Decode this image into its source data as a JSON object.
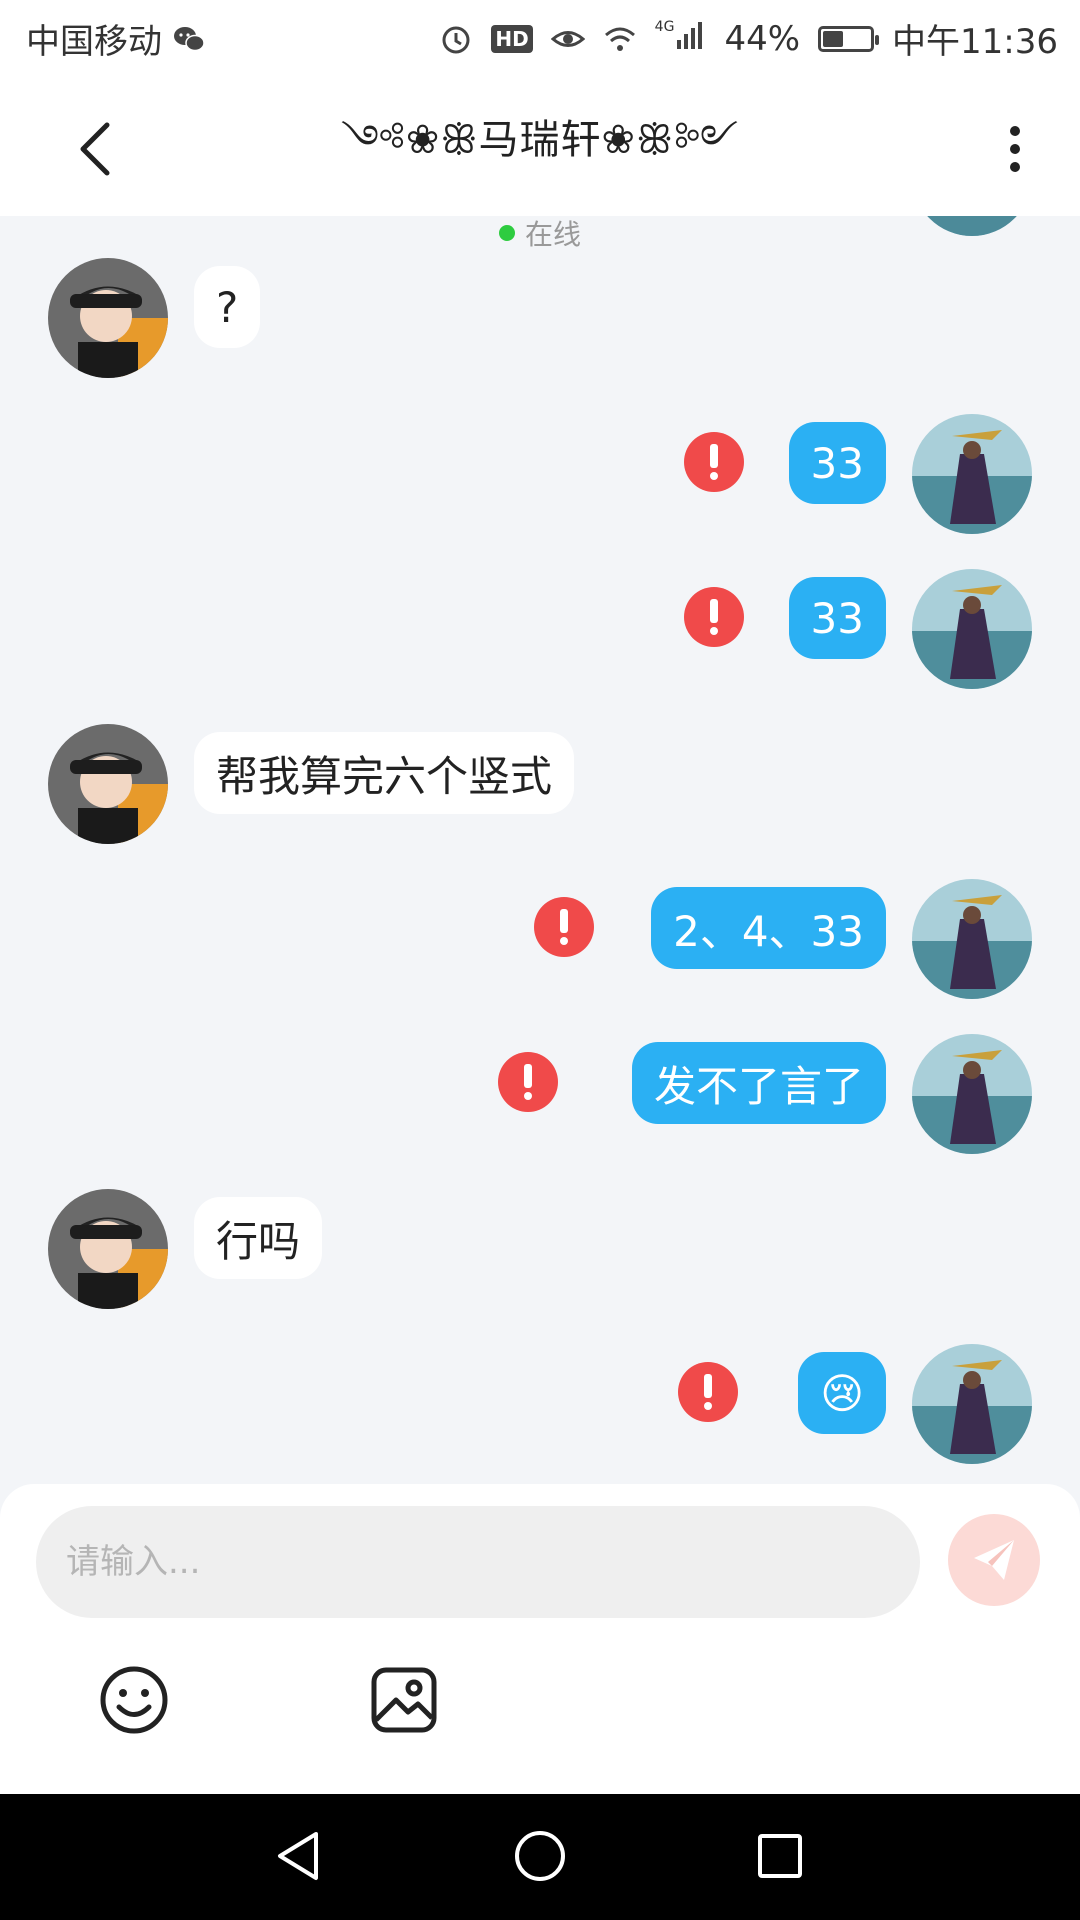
{
  "status_bar": {
    "carrier": "中国移动",
    "hd": "HD",
    "network": "4G",
    "battery": "44%",
    "battery_level": 0.44,
    "time": "中午11:36"
  },
  "header": {
    "title": "༺❀ꕥ马瑞轩❀ꕥ༻",
    "status": "在线",
    "status_color": "#2ecc40"
  },
  "messages": [
    {
      "side": "in",
      "text": "?",
      "failed": false
    },
    {
      "side": "out",
      "text": "33",
      "failed": true
    },
    {
      "side": "out",
      "text": "33",
      "failed": true
    },
    {
      "side": "in",
      "text": "帮我算完六个竖式",
      "failed": false
    },
    {
      "side": "out",
      "text": "2、4、33",
      "failed": true
    },
    {
      "side": "out",
      "text": "发不了言了",
      "failed": true
    },
    {
      "side": "in",
      "text": "行吗",
      "failed": false
    },
    {
      "side": "out",
      "text": "😢",
      "failed": true
    }
  ],
  "composer": {
    "placeholder": "请输入...",
    "value": "",
    "send_icon": "paper-plane-icon",
    "tools": [
      "smiley-icon",
      "image-icon"
    ]
  },
  "colors": {
    "outgoing_bubble": "#2bb0f3",
    "incoming_bubble": "#ffffff",
    "error": "#f04a4a",
    "background": "#f3f5f8"
  }
}
